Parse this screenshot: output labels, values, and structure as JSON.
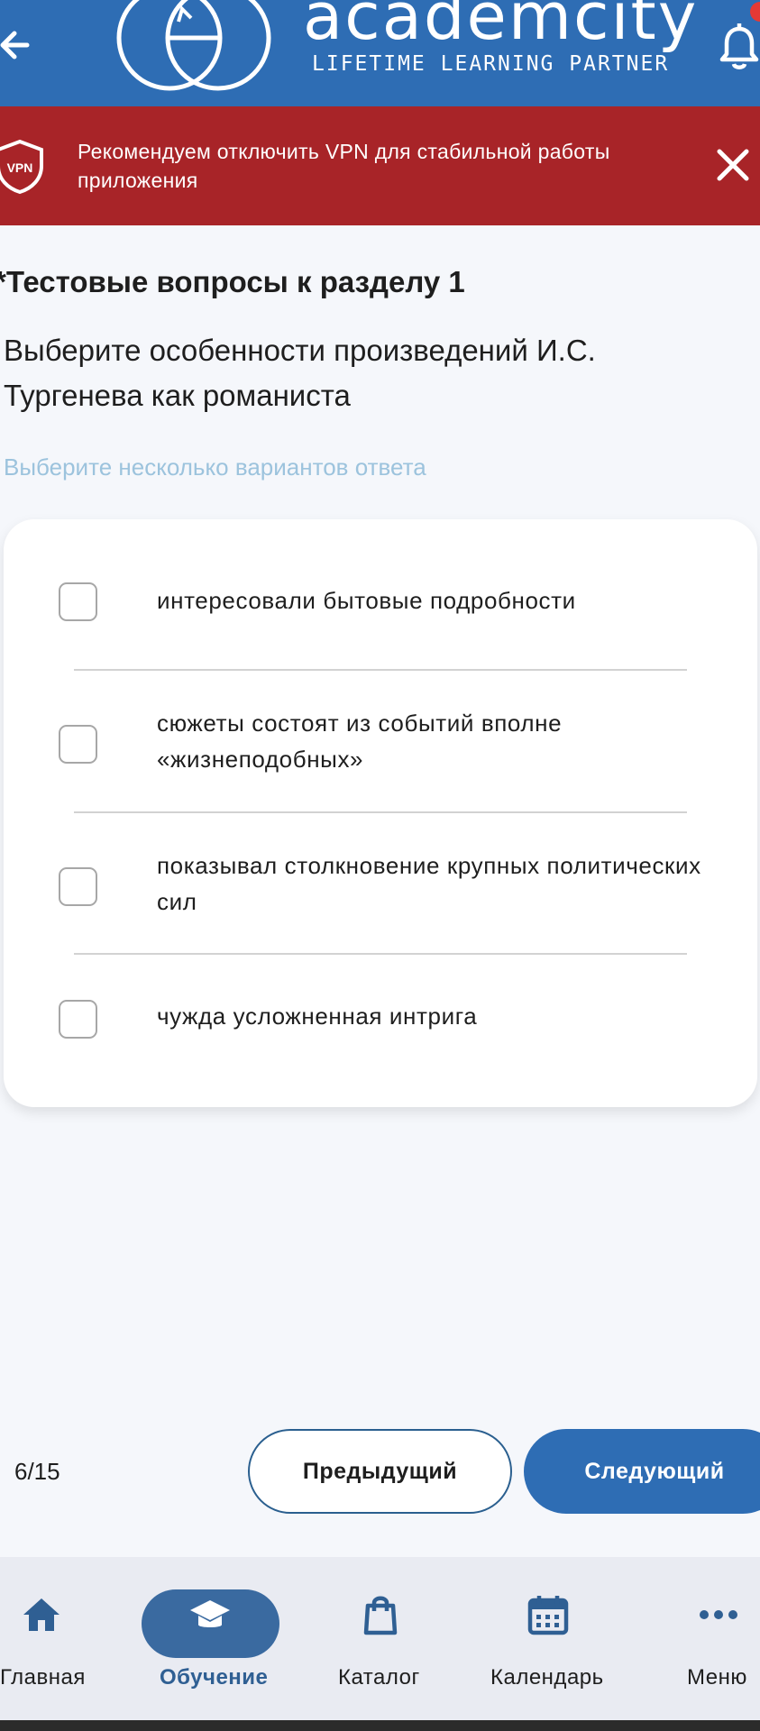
{
  "header": {
    "logo_word": "academcity",
    "logo_tagline": "LIFETIME LEARNING PARTNER",
    "back_icon": "arrow-left-icon",
    "notifications_icon": "bell-icon"
  },
  "vpn_banner": {
    "badge": "VPN",
    "message": "Рекомендуем отключить VPN для стабильной работы приложения",
    "close_icon": "close-icon"
  },
  "quiz": {
    "section_title": "*Тестовые вопросы к разделу 1",
    "question": "Выберите особенности произведений И.С. Тургенева как романиста",
    "hint": "Выберите несколько вариантов ответа",
    "options": [
      {
        "label": "интересовали бытовые подробности",
        "checked": false
      },
      {
        "label": "сюжеты состоят из событий вполне «жизнеподобных»",
        "checked": false
      },
      {
        "label": "показывал столкновение крупных политических сил",
        "checked": false
      },
      {
        "label": "чужда усложненная интрига",
        "checked": false
      }
    ],
    "counter": "6/15",
    "prev_label": "Предыдущий",
    "next_label": "Следующий"
  },
  "bottom_nav": {
    "items": [
      {
        "label": "Главная",
        "icon": "home-icon",
        "active": false
      },
      {
        "label": "Обучение",
        "icon": "graduation-cap-icon",
        "active": true
      },
      {
        "label": "Каталог",
        "icon": "shopping-bag-icon",
        "active": false
      },
      {
        "label": "Календарь",
        "icon": "calendar-icon",
        "active": false
      },
      {
        "label": "Меню",
        "icon": "more-dots-icon",
        "active": false
      }
    ]
  },
  "colors": {
    "brand_blue": "#2e6db4",
    "banner_red": "#a82428",
    "hint_blue": "#9cc3dd",
    "background": "#f5f7fb"
  }
}
